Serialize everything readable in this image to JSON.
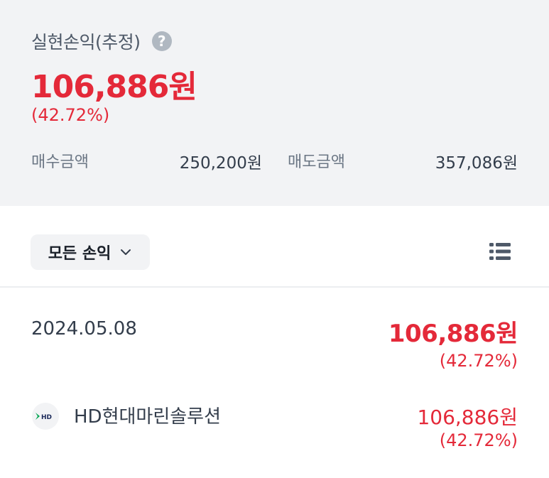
{
  "summary": {
    "title": "실현손익(추정)",
    "help_icon": "question-icon",
    "amount": "106,886원",
    "rate": "(42.72%)",
    "buy_label": "매수금액",
    "buy_value": "250,200원",
    "sell_label": "매도금액",
    "sell_value": "357,086원"
  },
  "toolbar": {
    "filter_label": "모든 손익",
    "filter_icon": "chevron-down-icon",
    "list_icon": "list-view-icon"
  },
  "records": [
    {
      "date": "2024.05.08",
      "amount": "106,886원",
      "rate": "(42.72%)",
      "items": [
        {
          "logo_text": "HD",
          "name": "HD현대마린솔루션",
          "amount": "106,886원",
          "rate": "(42.72%)"
        }
      ]
    }
  ],
  "colors": {
    "profit": "#e42939",
    "summary_bg": "#f2f3f5",
    "logo_green": "#00a651"
  }
}
